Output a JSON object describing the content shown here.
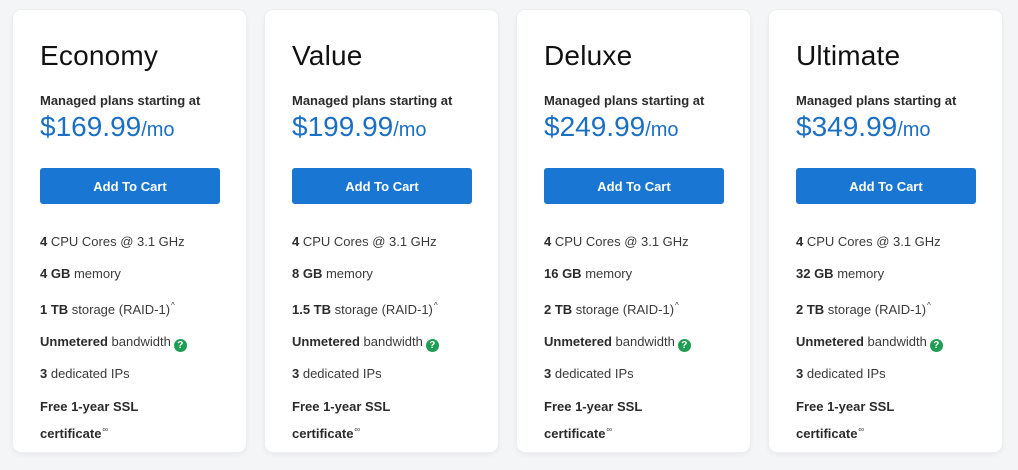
{
  "plans": [
    {
      "name": "Economy",
      "managed_label": "Managed plans starting at",
      "price": "$169.99",
      "period": "/mo",
      "button": "Add To Cart",
      "cpu": {
        "bold": "4",
        "text": " CPU Cores @ 3.1 GHz"
      },
      "memory": {
        "bold": "4 GB",
        "text": " memory"
      },
      "storage": {
        "bold": "1 TB",
        "text": " storage (RAID-1)",
        "sup": "^"
      },
      "bandwidth": {
        "bold": "Unmetered",
        "text": " bandwidth",
        "icon": "?"
      },
      "ips": {
        "bold": "3",
        "text": " dedicated IPs"
      },
      "ssl": {
        "bold": "Free 1-year SSL certificate",
        "sup": "∞"
      }
    },
    {
      "name": "Value",
      "managed_label": "Managed plans starting at",
      "price": "$199.99",
      "period": "/mo",
      "button": "Add To Cart",
      "cpu": {
        "bold": "4",
        "text": " CPU Cores @ 3.1 GHz"
      },
      "memory": {
        "bold": "8 GB",
        "text": " memory"
      },
      "storage": {
        "bold": "1.5 TB",
        "text": " storage (RAID-1)",
        "sup": "^"
      },
      "bandwidth": {
        "bold": "Unmetered",
        "text": " bandwidth",
        "icon": "?"
      },
      "ips": {
        "bold": "3",
        "text": " dedicated IPs"
      },
      "ssl": {
        "bold": "Free 1-year SSL certificate",
        "sup": "∞"
      }
    },
    {
      "name": "Deluxe",
      "managed_label": "Managed plans starting at",
      "price": "$249.99",
      "period": "/mo",
      "button": "Add To Cart",
      "cpu": {
        "bold": "4",
        "text": " CPU Cores @ 3.1 GHz"
      },
      "memory": {
        "bold": "16 GB",
        "text": " memory"
      },
      "storage": {
        "bold": "2 TB",
        "text": " storage (RAID-1)",
        "sup": "^"
      },
      "bandwidth": {
        "bold": "Unmetered",
        "text": " bandwidth",
        "icon": "?"
      },
      "ips": {
        "bold": "3",
        "text": " dedicated IPs"
      },
      "ssl": {
        "bold": "Free 1-year SSL certificate",
        "sup": "∞"
      }
    },
    {
      "name": "Ultimate",
      "managed_label": "Managed plans starting at",
      "price": "$349.99",
      "period": "/mo",
      "button": "Add To Cart",
      "cpu": {
        "bold": "4",
        "text": " CPU Cores @ 3.1 GHz"
      },
      "memory": {
        "bold": "32 GB",
        "text": " memory"
      },
      "storage": {
        "bold": "2 TB",
        "text": " storage (RAID-1)",
        "sup": "^"
      },
      "bandwidth": {
        "bold": "Unmetered",
        "text": " bandwidth",
        "icon": "?"
      },
      "ips": {
        "bold": "3",
        "text": " dedicated IPs"
      },
      "ssl": {
        "bold": "Free 1-year SSL certificate",
        "sup": "∞"
      }
    }
  ],
  "colors": {
    "price": "#1b6fc4",
    "button": "#1976d2",
    "help_icon": "#1f9d55",
    "background": "#f4f5f6"
  },
  "icons": {
    "help": "help-circle-icon"
  }
}
